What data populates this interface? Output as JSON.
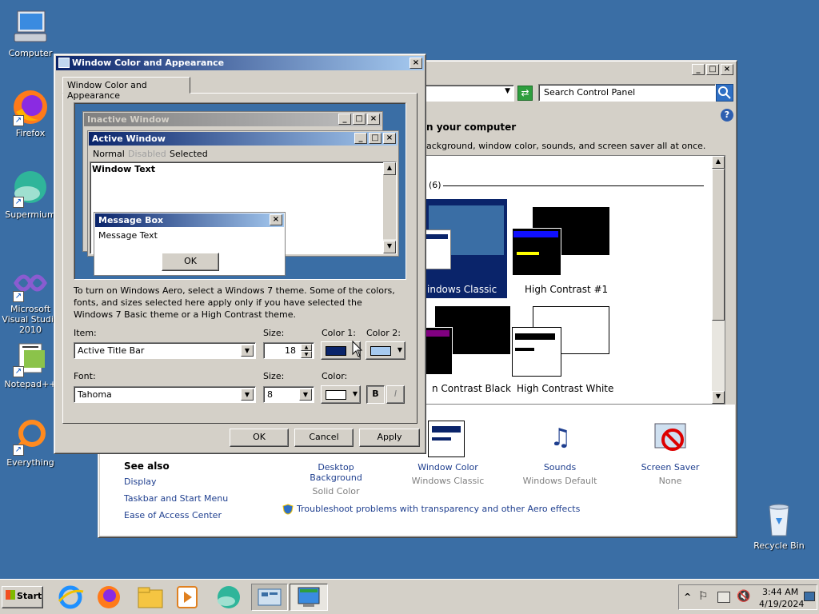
{
  "desktop": {
    "icons": [
      {
        "label": "Computer"
      },
      {
        "label": "Firefox"
      },
      {
        "label": "Supermium"
      },
      {
        "label": "Microsoft Visual Studio 2010"
      },
      {
        "label": "Notepad++"
      },
      {
        "label": "Everything"
      },
      {
        "label": "Recycle Bin"
      }
    ]
  },
  "control_panel": {
    "search_placeholder": "Search Control Panel",
    "heading": "n your computer",
    "subtitle": "ackground, window color, sounds, and screen saver all at once.",
    "section_count": "(6)",
    "themes": [
      {
        "label": "indows Classic"
      },
      {
        "label": "High Contrast #1"
      },
      {
        "label": "n Contrast Black"
      },
      {
        "label": "High Contrast White"
      }
    ],
    "settings": [
      {
        "label": "Desktop Background",
        "value": "Solid Color"
      },
      {
        "label": "Window Color",
        "value": "Windows Classic"
      },
      {
        "label": "Sounds",
        "value": "Windows Default"
      },
      {
        "label": "Screen Saver",
        "value": "None"
      }
    ],
    "see_also": {
      "title": "See also",
      "links": [
        "Display",
        "Taskbar and Start Menu",
        "Ease of Access Center"
      ]
    },
    "troubleshoot": "Troubleshoot problems with transparency and other Aero effects"
  },
  "dialog": {
    "title": "Window Color and Appearance",
    "tab": "Window Color and Appearance",
    "preview": {
      "inactive_title": "Inactive Window",
      "active_title": "Active Window",
      "menu": [
        "Normal",
        "Disabled",
        "Selected"
      ],
      "window_text": "Window Text",
      "msgbox_title": "Message Box",
      "msgbox_text": "Message Text",
      "msgbox_ok": "OK"
    },
    "info": "To turn on Windows Aero, select a Windows 7 theme.  Some of the colors, fonts, and sizes selected here apply only if you have selected the Windows 7 Basic theme or a High Contrast theme.",
    "labels": {
      "item": "Item:",
      "size": "Size:",
      "color1": "Color 1:",
      "color2": "Color 2:",
      "font": "Font:",
      "font_size": "Size:",
      "color": "Color:"
    },
    "item_value": "Active Title Bar",
    "size_value": "18",
    "font_value": "Tahoma",
    "font_size_value": "8",
    "bold": "B",
    "italic": "I",
    "buttons": {
      "ok": "OK",
      "cancel": "Cancel",
      "apply": "Apply"
    },
    "colors": {
      "color1": "#0a246a",
      "color2": "#a6caf0",
      "font_color": "#ffffff"
    }
  },
  "taskbar": {
    "start": "Start",
    "time": "3:44 AM",
    "date": "4/19/2024"
  }
}
